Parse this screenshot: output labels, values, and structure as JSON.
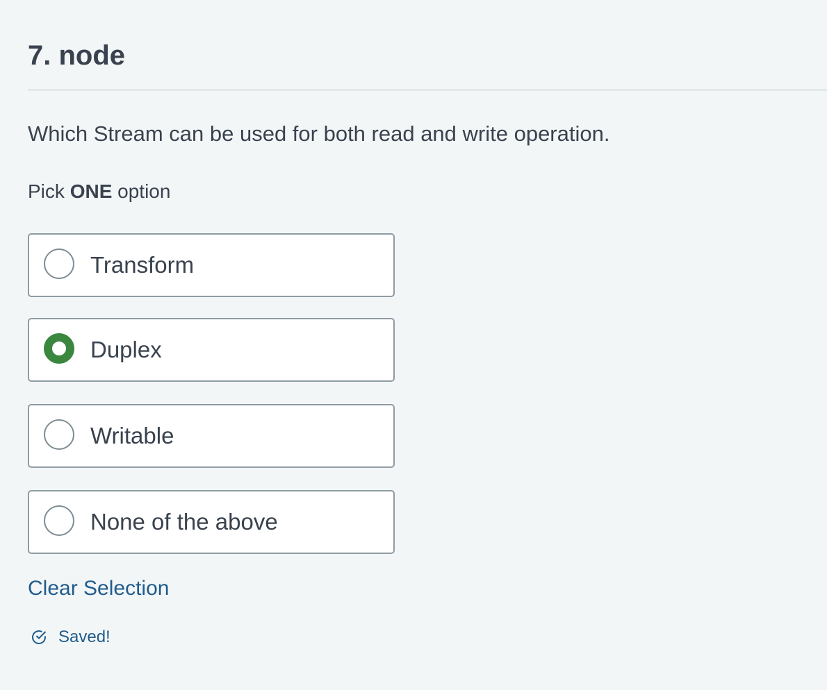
{
  "question": {
    "title": "7. node",
    "text": "Which Stream can be used for both read and write operation.",
    "instruction": {
      "prefix": "Pick",
      "emphasis": "ONE",
      "suffix": "option"
    }
  },
  "options": [
    {
      "label": "Transform",
      "selected": false
    },
    {
      "label": "Duplex",
      "selected": true
    },
    {
      "label": "Writable",
      "selected": false
    },
    {
      "label": "None of the above",
      "selected": false
    }
  ],
  "clear_selection_label": "Clear Selection",
  "status": {
    "icon": "check-circle-icon",
    "text": "Saved!"
  },
  "colors": {
    "background": "#f3f6f7",
    "selected_radio": "#3b8740",
    "link": "#1f5c8c",
    "text": "#39424e"
  }
}
